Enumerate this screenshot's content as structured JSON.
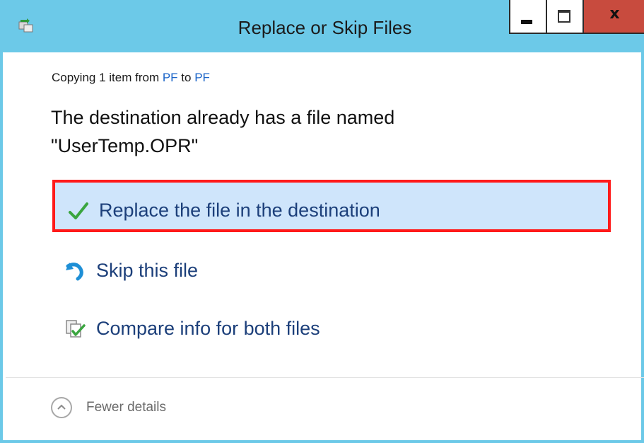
{
  "window": {
    "title": "Replace or Skip Files",
    "icon": "file-transfer-icon",
    "accent_color": "#6cc9e8",
    "close_color": "#c84b3e"
  },
  "controls": {
    "minimize": "minimize-icon",
    "maximize": "maximize-icon",
    "close_label": "x"
  },
  "copying": {
    "prefix": "Copying 1 item from ",
    "source": "PF",
    "middle": " to ",
    "destination": "PF"
  },
  "message": {
    "line1": "The destination already has a file named",
    "line2": "\"UserTemp.OPR\""
  },
  "options": [
    {
      "label": "Replace the file in the destination",
      "icon": "checkmark-icon",
      "selected": true
    },
    {
      "label": "Skip this file",
      "icon": "skip-arrow-icon",
      "selected": false
    },
    {
      "label": "Compare info for both files",
      "icon": "compare-files-icon",
      "selected": false
    }
  ],
  "footer": {
    "details_label": "Fewer details",
    "icon": "chevron-up-icon"
  }
}
